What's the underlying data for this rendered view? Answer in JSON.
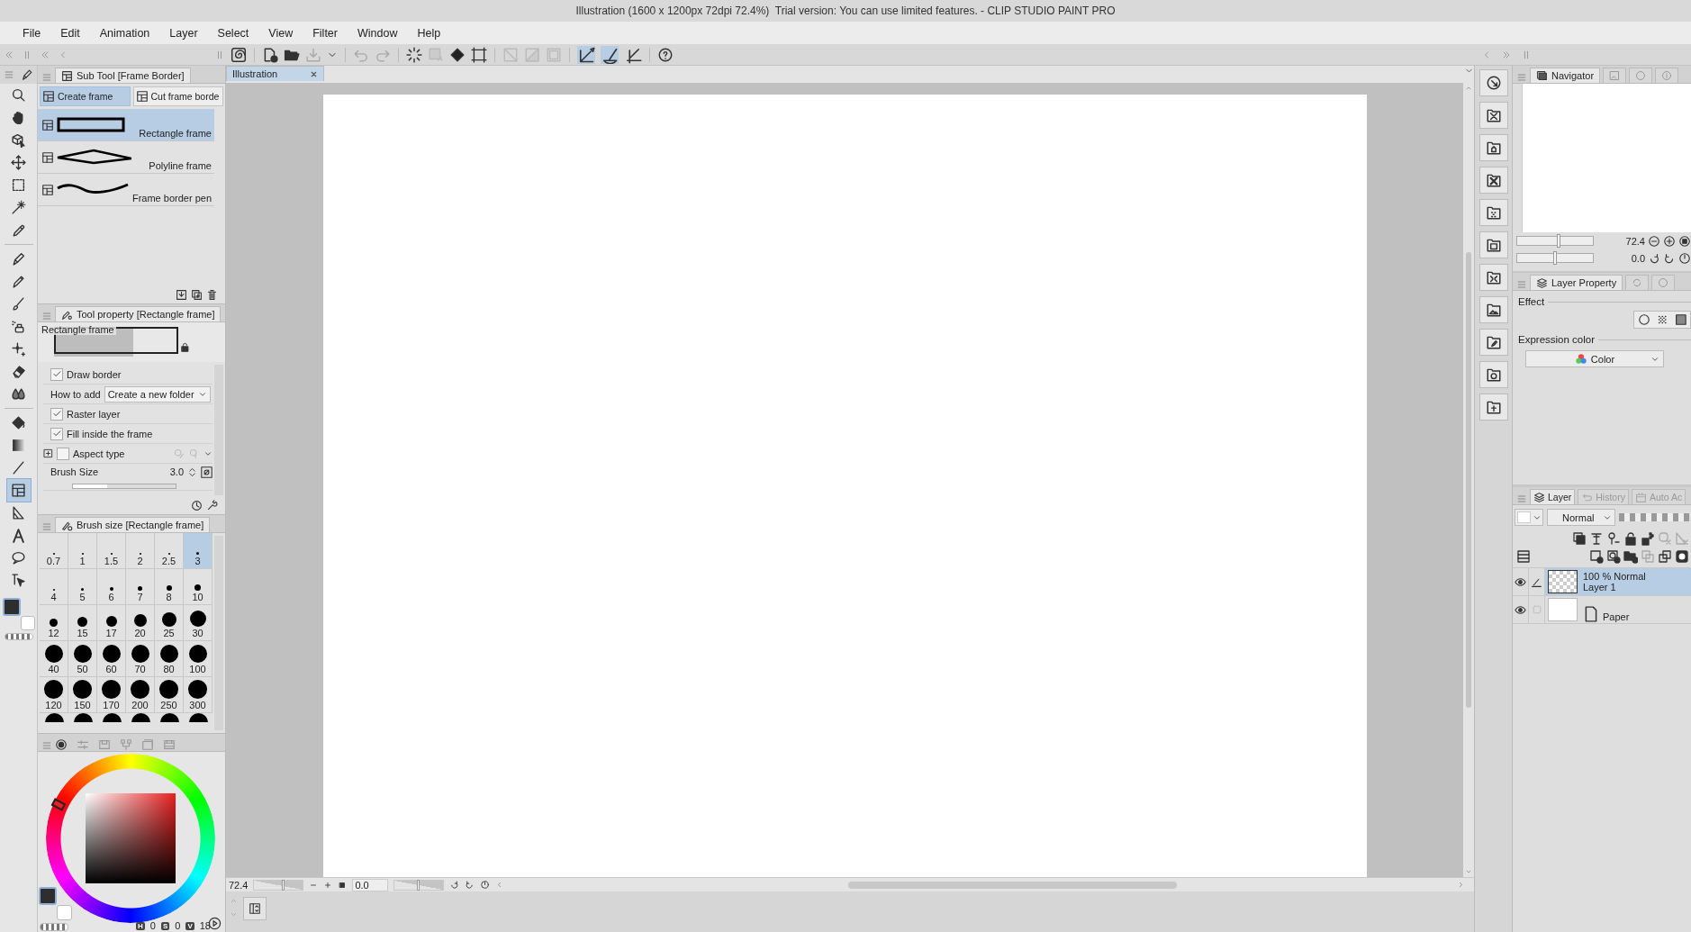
{
  "window": {
    "title": "Illustration (1600 x 1200px 72dpi 72.4%)  Trial version: You can use limited features. - CLIP STUDIO PAINT PRO"
  },
  "menu": [
    "File",
    "Edit",
    "Animation",
    "Layer",
    "Select",
    "View",
    "Filter",
    "Window",
    "Help"
  ],
  "snap_buttons": [
    {
      "selected": true
    },
    {
      "selected": true
    },
    {
      "selected": false
    }
  ],
  "tools": [
    {
      "selected": false
    },
    {
      "selected": false
    },
    {
      "selected": false
    },
    {
      "selected": false
    },
    {
      "selected": false
    },
    {
      "selected": false
    },
    {
      "selected": false
    },
    {
      "selected": false
    },
    {
      "selected": false
    },
    {
      "selected": false
    },
    {
      "selected": false
    },
    {
      "selected": false
    },
    {
      "selected": false
    },
    {
      "selected": false
    },
    {
      "selected": false
    },
    {
      "selected": false
    },
    {
      "selected": false
    },
    {
      "selected": true
    },
    {
      "selected": false
    },
    {
      "selected": false
    },
    {
      "selected": false
    },
    {
      "selected": false
    }
  ],
  "sub_tool": {
    "title": "Sub Tool [Frame Border]",
    "groups": [
      {
        "label": "Create frame",
        "selected": true
      },
      {
        "label": "Cut frame borde",
        "selected": false
      }
    ],
    "items": [
      {
        "label": "Rectangle frame",
        "selected": true
      },
      {
        "label": "Polyline frame",
        "selected": false
      },
      {
        "label": "Frame border pen",
        "selected": false
      }
    ]
  },
  "tool_property": {
    "title": "Tool property [Rectangle frame]",
    "preview_label": "Rectangle frame",
    "rows": [
      {
        "kind": "checkbox",
        "label": "Draw border",
        "checked": true
      },
      {
        "kind": "select",
        "label": "How to add",
        "value": "Create a new folder"
      },
      {
        "kind": "checkbox",
        "label": "Raster layer",
        "checked": true
      },
      {
        "kind": "checkbox",
        "label": "Fill inside the frame",
        "checked": true
      },
      {
        "kind": "expand",
        "label": "Aspect type",
        "checked": false
      },
      {
        "kind": "slider",
        "label": "Brush Size",
        "value": "3.0",
        "level": 0.33
      }
    ]
  },
  "brush_size": {
    "title": "Brush size [Rectangle frame]",
    "sizes": [
      {
        "label": "0.7",
        "selected": false
      },
      {
        "label": "1",
        "selected": false
      },
      {
        "label": "1.5",
        "selected": false
      },
      {
        "label": "2",
        "selected": false
      },
      {
        "label": "2.5",
        "selected": false
      },
      {
        "label": "3",
        "selected": true
      },
      {
        "label": "4",
        "selected": false
      },
      {
        "label": "5",
        "selected": false
      },
      {
        "label": "6",
        "selected": false
      },
      {
        "label": "7",
        "selected": false
      },
      {
        "label": "8",
        "selected": false
      },
      {
        "label": "10",
        "selected": false
      },
      {
        "label": "12",
        "selected": false
      },
      {
        "label": "15",
        "selected": false
      },
      {
        "label": "17",
        "selected": false
      },
      {
        "label": "20",
        "selected": false
      },
      {
        "label": "25",
        "selected": false
      },
      {
        "label": "30",
        "selected": false
      },
      {
        "label": "40",
        "selected": false
      },
      {
        "label": "50",
        "selected": false
      },
      {
        "label": "60",
        "selected": false
      },
      {
        "label": "70",
        "selected": false
      },
      {
        "label": "80",
        "selected": false
      },
      {
        "label": "100",
        "selected": false
      },
      {
        "label": "120",
        "selected": false
      },
      {
        "label": "150",
        "selected": false
      },
      {
        "label": "170",
        "selected": false
      },
      {
        "label": "200",
        "selected": false
      },
      {
        "label": "250",
        "selected": false
      },
      {
        "label": "300",
        "selected": false
      }
    ]
  },
  "color": {
    "hsv": [
      {
        "label": "H",
        "value": "0"
      },
      {
        "label": "S",
        "value": "0"
      },
      {
        "label": "V",
        "value": "18"
      }
    ]
  },
  "canvas": {
    "tab": "Illustration",
    "zoom": "72.4",
    "angle": "0.0",
    "zoom_slider": {
      "level": 0.6
    },
    "rotation_slider": {
      "level": 0.5
    }
  },
  "navigator": {
    "title": "Navigator",
    "zoom": "72.4",
    "angle": "0.0",
    "zoom_slider": {
      "level": 0.55
    },
    "angle_slider": {
      "level": 0.5
    }
  },
  "layer_property": {
    "title": "Layer Property",
    "effect_label": "Effect",
    "expression_label": "Expression color",
    "expression_value": "Color"
  },
  "layers": {
    "tabs": [
      {
        "label": "Layer",
        "selected": true
      },
      {
        "label": "History",
        "selected": false
      },
      {
        "label": "Auto Ac",
        "selected": false
      }
    ],
    "blend_mode": "Normal",
    "opacity": {
      "level": 1
    },
    "items": [
      {
        "kind": "raster",
        "info": "100 % Normal",
        "name": "Layer 1",
        "selected": true,
        "visible": true
      },
      {
        "kind": "paper",
        "name": "Paper",
        "selected": false,
        "visible": true
      }
    ]
  }
}
